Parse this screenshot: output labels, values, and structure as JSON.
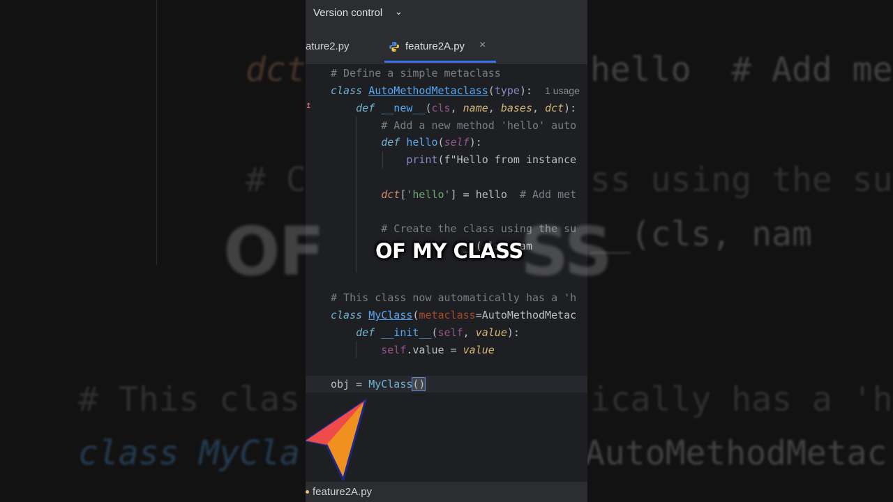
{
  "background": {
    "lines": [
      {
        "text": "dct",
        "color": "#cf8e6d"
      },
      {
        "text": "hello  # Add met",
        "color": "#bcbec4"
      },
      {
        "text": "# C",
        "color": "#7a7e85"
      },
      {
        "text": "ss using the su",
        "color": "#7a7e85"
      },
      {
        "text": "__(cls, nam",
        "color": "#bcbec4"
      },
      {
        "text": "# This clas",
        "color": "#7a7e85"
      },
      {
        "text": "ically has a 'h",
        "color": "#7a7e85"
      },
      {
        "text": "class MyCla",
        "color": "#56a8f5"
      },
      {
        "text": "AutoMethodMetac",
        "color": "#bcbec4"
      }
    ]
  },
  "header": {
    "version_control_label": "Version control"
  },
  "tabs": [
    {
      "label": "ature2.py"
    },
    {
      "label": "feature2A.py",
      "active": true
    }
  ],
  "editor": {
    "line1": "# Define a simple metaclass",
    "line2_kw": "class",
    "line2_cls": "AutoMethodMetaclass",
    "line2_type": "type",
    "line2_hint": "1 usage",
    "line3_kw": "def",
    "line3_fn": "__new__",
    "line3_params": [
      "cls",
      "name",
      "bases",
      "dct"
    ],
    "line4": "# Add a new method 'hello' auto",
    "line5_kw": "def",
    "line5_fn": "hello",
    "line5_param": "self",
    "line6_fn": "print",
    "line6_str": "f\"Hello from instance",
    "line7_var": "dct",
    "line7_key": "'hello'",
    "line7_val": "hello",
    "line7_comment": "# Add met",
    "line8": "# Create the class using the su",
    "line9_tail": "__(cls, nam",
    "line10": "# This class now automatically has a 'h",
    "line11_kw": "class",
    "line11_cls": "MyClass",
    "line11_arg": "metaclass",
    "line11_val": "AutoMethodMetac",
    "line12_kw": "def",
    "line12_fn": "__init__",
    "line12_self": "self",
    "line12_param": "value",
    "line13_self": "self",
    "line13_attr": "value",
    "line13_val": "value",
    "line14_var": "obj",
    "line14_cls": "MyClass"
  },
  "status_bar": {
    "file": "feature2A.py"
  },
  "caption": {
    "text": "OF MY CLASS",
    "background_text": "OF         SS"
  },
  "colors": {
    "accent": "#3574f0",
    "panel_bg": "#2b2d30",
    "editor_bg": "#1e1f22",
    "cursor_red": "#ef4b4b",
    "cursor_orange": "#f0901e",
    "cursor_outline": "#1b2a8a"
  },
  "icons": {
    "chevron": "chevron-down-icon",
    "python": "python-file-icon",
    "close": "close-icon",
    "cursor": "pointer-cursor-icon"
  }
}
